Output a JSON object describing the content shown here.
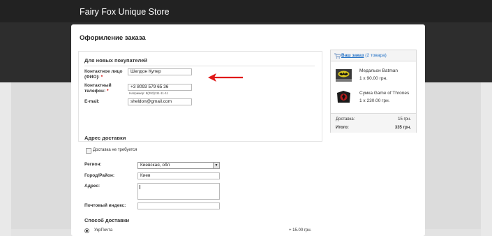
{
  "store": {
    "title": "Fairy Fox Unique Store"
  },
  "checkout": {
    "title": "Оформление заказа",
    "new_customers": {
      "title": "Для новых покупателей",
      "contact_name_label_1": "Контактное лицо",
      "contact_name_label_2": "(ФИО):",
      "contact_name_value": "Шелдон Купер",
      "phone_label_1": "Контактный",
      "phone_label_2": "телефон:",
      "phone_value": "+3 8093 579 65 36",
      "phone_hint": "Например: 8(093)111-11-11",
      "email_label": "E-mail:",
      "email_value": "sheldon@gmail.com",
      "required_mark": "*"
    },
    "delivery_address": {
      "title": "Адрес доставки",
      "no_delivery_label": "Доставка не требуется",
      "region_label": "Регион:",
      "region_value": "Киевская, обл",
      "city_label": "Город/Район:",
      "city_value": "Киев",
      "address_label": "Адрес:",
      "postcode_label": "Почтовый индекс:"
    },
    "delivery_method": {
      "title": "Способ доставки",
      "option_name": "УкрПочта",
      "option_price": "+ 15.00 грн."
    }
  },
  "order": {
    "link_prefix": "Ваш заказ",
    "link_count": "(2 товара)",
    "items": [
      {
        "name": "Медальон Batman",
        "qty": "1 x 90.00 грн."
      },
      {
        "name": "Сумка Game of Thrones",
        "qty": "1 x 230.00 грн."
      }
    ],
    "delivery_label": "Доставка:",
    "delivery_value": "15 грн.",
    "total_label": "Итого:",
    "total_value": "335 грн."
  },
  "colors": {
    "header_bg": "#2d2d2d",
    "link": "#1f6fc5",
    "required": "#cc0000",
    "arrow": "#e01818"
  },
  "icons": [
    "cart-icon",
    "select-arrow-icon",
    "red-arrow-annotation"
  ]
}
